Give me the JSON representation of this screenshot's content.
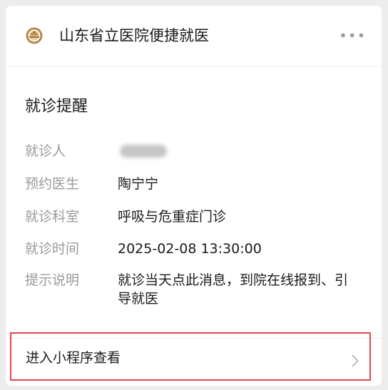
{
  "header": {
    "app_name": "山东省立医院便捷就医",
    "more_label": "•••"
  },
  "notice": {
    "title": "就诊提醒",
    "rows": [
      {
        "label": "就诊人",
        "value": ""
      },
      {
        "label": "预约医生",
        "value": "陶宁宁"
      },
      {
        "label": "就诊科室",
        "value": "呼吸与危重症门诊"
      },
      {
        "label": "就诊时间",
        "value": "2025-02-08 13:30:00"
      },
      {
        "label": "提示说明",
        "value": "就诊当天点此消息，到院在线报到、引导就医"
      }
    ]
  },
  "footer": {
    "entry_label": "进入小程序查看"
  },
  "colors": {
    "highlight": "#e2484e",
    "label_gray": "#9a9a9a",
    "text": "#1a1a1a"
  },
  "icons": {
    "logo": "hospital-emblem-icon",
    "more": "more-dots-icon",
    "chevron": "chevron-right-icon"
  }
}
